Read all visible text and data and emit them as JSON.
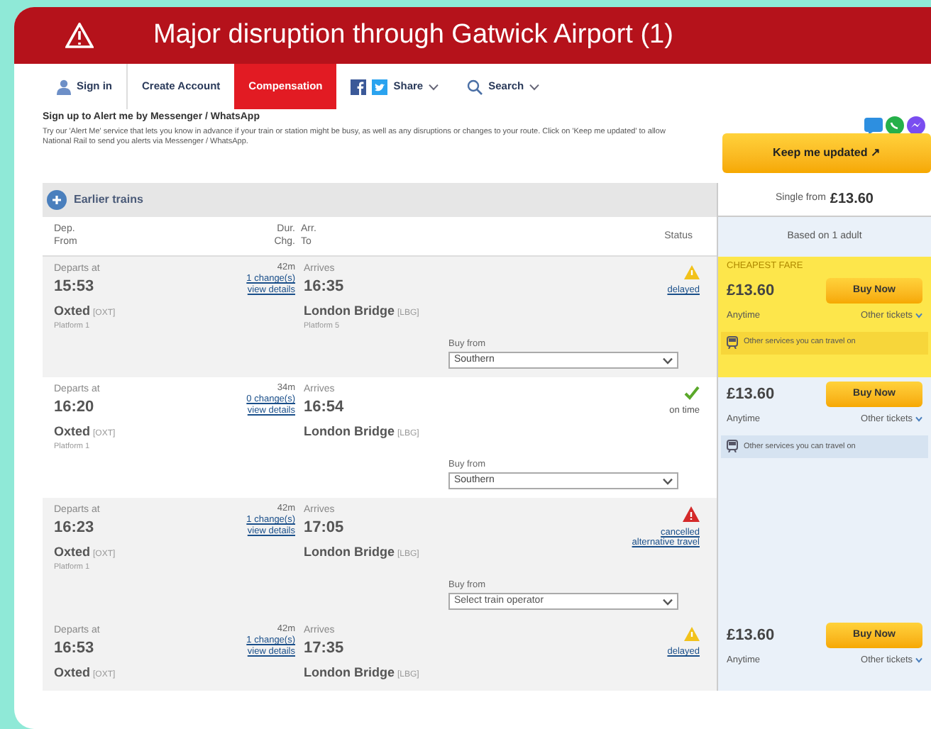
{
  "banner": {
    "title": "Major disruption through Gatwick Airport (1)"
  },
  "nav": [
    {
      "kind": "signin",
      "label": "Sign in",
      "selected": false
    },
    {
      "kind": "link",
      "label": "Create Account",
      "selected": false
    },
    {
      "kind": "link",
      "label": "Compensation",
      "selected": true
    },
    {
      "kind": "share",
      "label": "Share",
      "selected": false
    },
    {
      "kind": "search",
      "label": "Search",
      "selected": false
    }
  ],
  "alert": {
    "heading": "Sign up to Alert me by Messenger / WhatsApp",
    "text": "Try our 'Alert Me' service that lets you know in advance if your train or station might be busy, as well as any disruptions or changes to your route. Click on 'Keep me updated' to allow National Rail to send you alerts via Messenger / WhatsApp.",
    "button": "Keep me updated ↗"
  },
  "earlier": "Earlier trains",
  "fare_header": {
    "single": "Single from",
    "price": "£13.60",
    "based_on": "Based on 1 adult"
  },
  "columns": [
    {
      "top": "Dep.",
      "bottom": "From"
    },
    {
      "top": "Dur.",
      "bottom": "Chg."
    },
    {
      "top": "Arr.",
      "bottom": "To"
    },
    {
      "bottom": "Status"
    }
  ],
  "journeys": [
    {
      "depart_label": "Departs at",
      "depart_time": "15:53",
      "origin": "Oxted",
      "origin_code": "[OXT]",
      "origin_platform": "Platform 1",
      "duration": "42m",
      "changes": "1 change(s)",
      "details": "view details",
      "arrive_label": "Arrives",
      "arrive_time": "16:35",
      "destination": "London Bridge",
      "destination_code": "[LBG]",
      "destination_platform": "Platform 5",
      "buy_from": "Buy from",
      "operator": "Southern",
      "status": {
        "kind": "warning",
        "text": "delayed"
      },
      "fare": {
        "cheapest": true,
        "label": "CHEAPEST FARE",
        "price": "£13.60",
        "buy": "Buy Now",
        "ticket": "Anytime",
        "other": "Other tickets",
        "services": "Other services you can travel on"
      }
    },
    {
      "depart_label": "Departs at",
      "depart_time": "16:20",
      "origin": "Oxted",
      "origin_code": "[OXT]",
      "origin_platform": "Platform 1",
      "duration": "34m",
      "changes": "0 change(s)",
      "details": "view details",
      "arrive_label": "Arrives",
      "arrive_time": "16:54",
      "destination": "London Bridge",
      "destination_code": "[LBG]",
      "buy_from": "Buy from",
      "operator": "Southern",
      "status": {
        "kind": "ok",
        "text": "on time"
      },
      "fare": {
        "cheapest": false,
        "price": "£13.60",
        "buy": "Buy Now",
        "ticket": "Anytime",
        "other": "Other tickets",
        "services": "Other services you can travel on"
      }
    },
    {
      "depart_label": "Departs at",
      "depart_time": "16:23",
      "origin": "Oxted",
      "origin_code": "[OXT]",
      "origin_platform": "Platform 1",
      "duration": "42m",
      "changes": "1 change(s)",
      "details": "view details",
      "arrive_label": "Arrives",
      "arrive_time": "17:05",
      "destination": "London Bridge",
      "destination_code": "[LBG]",
      "buy_from": "Buy from",
      "operator_placeholder": "Select train operator",
      "status": {
        "kind": "danger",
        "text": "cancelled alternative travel"
      }
    },
    {
      "depart_label": "Departs at",
      "depart_time": "16:53",
      "origin": "Oxted",
      "origin_code": "[OXT]",
      "duration": "42m",
      "changes": "1 change(s)",
      "details": "view details",
      "arrive_label": "Arrives",
      "arrive_time": "17:35",
      "destination": "London Bridge",
      "destination_code": "[LBG]",
      "status": {
        "kind": "warning",
        "text": "delayed"
      },
      "fare": {
        "cheapest": false,
        "price": "£13.60",
        "buy": "Buy Now",
        "ticket": "Anytime",
        "other": "Other tickets"
      }
    }
  ]
}
